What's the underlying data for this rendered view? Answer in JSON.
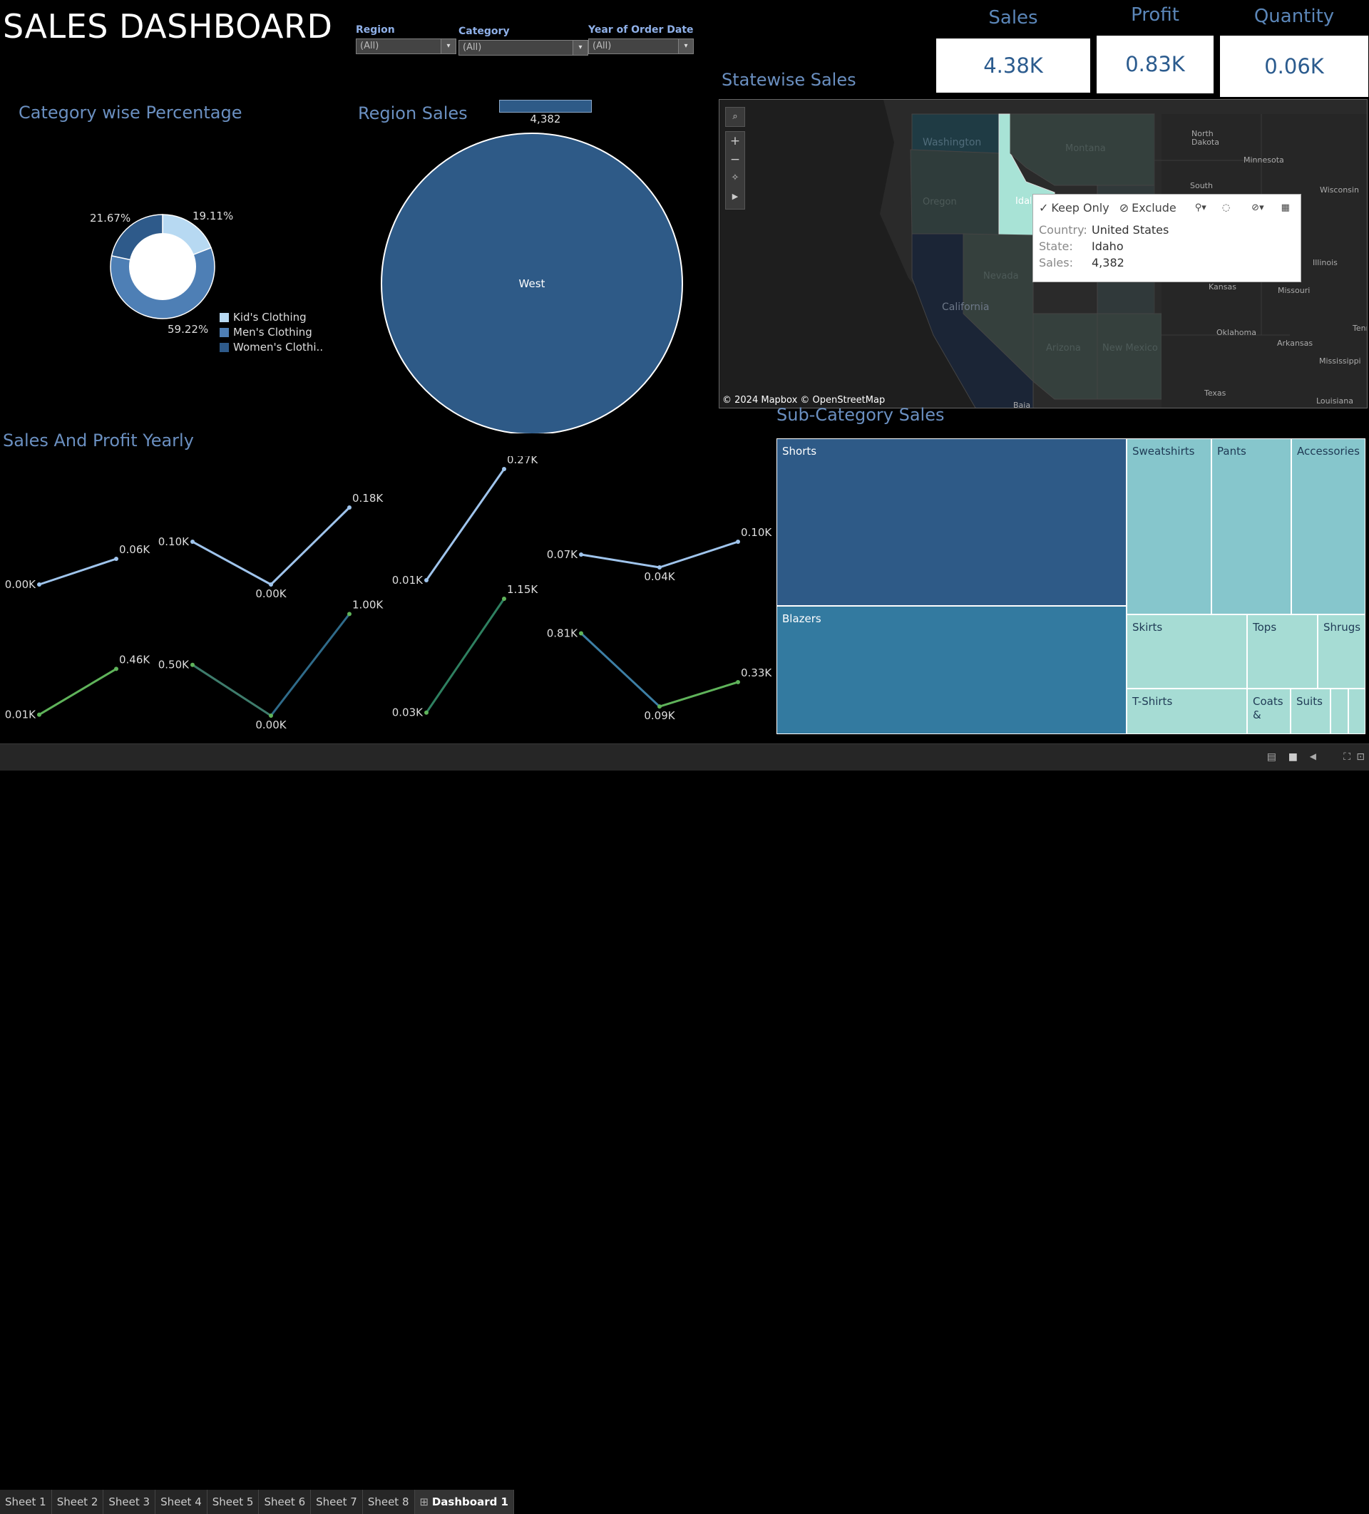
{
  "header": {
    "title": "SALES DASHBOARD"
  },
  "filters": [
    {
      "label": "Region",
      "value": "(All)"
    },
    {
      "label": "Category",
      "value": "(All)"
    },
    {
      "label": "Year of Order Date",
      "value": "(All)"
    }
  ],
  "kpis": [
    {
      "label": "Sales",
      "value": "4.38K"
    },
    {
      "label": "Profit",
      "value": "0.83K"
    },
    {
      "label": "Quantity",
      "value": "0.06K"
    }
  ],
  "category_section": {
    "title": "Category wise Percentage",
    "slices": [
      {
        "name": "Kid's Clothing",
        "pct": 19.11,
        "label": "19.11%",
        "color": "#b7d9f2"
      },
      {
        "name": "Men's Clothing",
        "pct": 59.22,
        "label": "59.22%",
        "color": "#4e7fb5"
      },
      {
        "name": "Women's Clothi..",
        "pct": 21.67,
        "label": "21.67%",
        "color": "#2e5a8a"
      }
    ]
  },
  "region_section": {
    "title": "Region Sales",
    "bar_value": "4,382",
    "pie_label": "West",
    "pie_color": "#2e5a87"
  },
  "map_section": {
    "title": "Statewise Sales",
    "attribution": "© 2024 Mapbox © OpenStreetMap",
    "states": [
      "Washington",
      "Oregon",
      "Idaho",
      "Montana",
      "Nevada",
      "California",
      "Arizona",
      "New Mexico"
    ],
    "place_labels": [
      "North Dakota",
      "Minnesota",
      "South",
      "Wisconsin",
      "Illinois",
      "Kansas",
      "Missouri",
      "Oklahoma",
      "Arkansas",
      "Mississippi",
      "Texas",
      "Louisiana",
      "Tenn",
      "Baja"
    ],
    "tooltip": {
      "keep_only": "Keep Only",
      "exclude": "Exclude",
      "rows": [
        {
          "key": "Country:",
          "value": "United States"
        },
        {
          "key": "State:",
          "value": "Idaho"
        },
        {
          "key": "Sales:",
          "value": "4,382"
        }
      ]
    }
  },
  "yearly_section": {
    "title": "Sales And Profit Yearly",
    "sales_color": "#9fc4ec",
    "profit_color": "#5fb35a",
    "panels": [
      {
        "sales": [
          0.0,
          0.06
        ],
        "sales_labels": [
          "0.00K",
          "0.06K"
        ],
        "profit": [
          0.01,
          0.46
        ],
        "profit_labels": [
          "0.01K",
          "0.46K"
        ]
      },
      {
        "sales": [
          0.1,
          0.0,
          0.18
        ],
        "sales_labels": [
          "0.10K",
          "0.00K",
          "0.18K"
        ],
        "profit": [
          0.5,
          0.0,
          1.0
        ],
        "profit_labels": [
          "0.50K",
          "0.00K",
          "1.00K"
        ]
      },
      {
        "sales": [
          0.01,
          0.27
        ],
        "sales_labels": [
          "0.01K",
          "0.27K"
        ],
        "profit": [
          0.03,
          1.15
        ],
        "profit_labels": [
          "0.03K",
          "1.15K"
        ]
      },
      {
        "sales": [
          0.07,
          0.04,
          0.1
        ],
        "sales_labels": [
          "0.07K",
          "0.04K",
          "0.10K"
        ],
        "profit": [
          0.81,
          0.09,
          0.33
        ],
        "profit_labels": [
          "0.81K",
          "0.09K",
          "0.33K"
        ]
      }
    ]
  },
  "subcategory_section": {
    "title": "Sub-Category Sales",
    "cells": [
      "Shorts",
      "Blazers",
      "Sweatshirts",
      "Pants",
      "Accessories",
      "Skirts",
      "Tops",
      "Shrugs",
      "T-Shirts",
      "Coats &",
      "Suits"
    ]
  },
  "tabs": [
    "Sheet 1",
    "Sheet 2",
    "Sheet 3",
    "Sheet 4",
    "Sheet 5",
    "Sheet 6",
    "Sheet 7",
    "Sheet 8",
    "Dashboard 1"
  ]
}
